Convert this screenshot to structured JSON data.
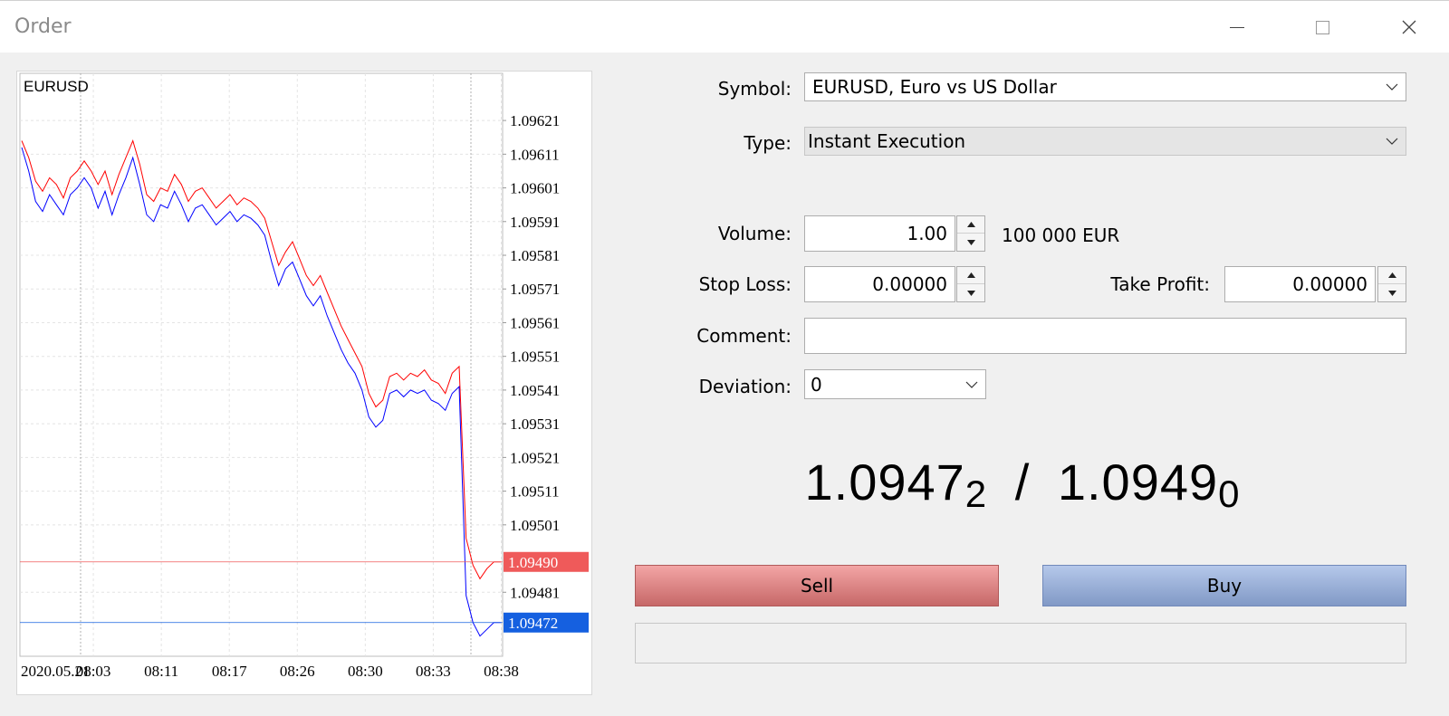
{
  "window": {
    "title": "Order",
    "controls": [
      "minimize",
      "maximize",
      "close"
    ]
  },
  "chart_data": {
    "type": "line",
    "symbol_label": "EURUSD",
    "x_tick_labels": [
      "2020.05.21",
      "08:03",
      "08:11",
      "08:17",
      "08:26",
      "08:30",
      "08:33",
      "08:38"
    ],
    "y_tick_labels": [
      "1.09621",
      "1.09611",
      "1.09601",
      "1.09591",
      "1.09581",
      "1.09571",
      "1.09561",
      "1.09551",
      "1.09541",
      "1.09531",
      "1.09521",
      "1.09511",
      "1.09501",
      "1.09481"
    ],
    "ylim": [
      1.09462,
      1.09635
    ],
    "grid": true,
    "current_ask": {
      "label": "1.09490",
      "value": 1.0949,
      "color": "#ef5a5a"
    },
    "current_bid": {
      "label": "1.09472",
      "value": 1.09472,
      "color": "#1560e0"
    },
    "series": [
      {
        "role": "ask",
        "color": "#ff0000",
        "values": [
          1.09615,
          1.0961,
          1.09603,
          1.096,
          1.09604,
          1.09602,
          1.09598,
          1.09604,
          1.09606,
          1.09609,
          1.09606,
          1.09602,
          1.09606,
          1.09599,
          1.09605,
          1.0961,
          1.09615,
          1.09608,
          1.09599,
          1.09597,
          1.09601,
          1.096,
          1.09605,
          1.09602,
          1.09597,
          1.096,
          1.09601,
          1.09598,
          1.09595,
          1.09597,
          1.09599,
          1.09596,
          1.09598,
          1.09597,
          1.09595,
          1.09592,
          1.09585,
          1.09578,
          1.09582,
          1.09585,
          1.0958,
          1.09575,
          1.09572,
          1.09575,
          1.0957,
          1.09565,
          1.0956,
          1.09556,
          1.09552,
          1.09548,
          1.0954,
          1.09536,
          1.09538,
          1.09545,
          1.09546,
          1.09544,
          1.09546,
          1.09545,
          1.09547,
          1.09544,
          1.09543,
          1.0954,
          1.09546,
          1.09548,
          1.09497,
          1.09489,
          1.09485,
          1.09488,
          1.0949,
          1.0949
        ]
      },
      {
        "role": "bid",
        "color": "#0000ff",
        "values": [
          1.09613,
          1.09606,
          1.09597,
          1.09594,
          1.09599,
          1.09596,
          1.09593,
          1.09599,
          1.09601,
          1.09604,
          1.09601,
          1.09595,
          1.096,
          1.09593,
          1.09599,
          1.09604,
          1.0961,
          1.09602,
          1.09593,
          1.09591,
          1.09596,
          1.09595,
          1.096,
          1.09596,
          1.09591,
          1.09595,
          1.09596,
          1.09593,
          1.0959,
          1.09592,
          1.09594,
          1.09591,
          1.09593,
          1.09592,
          1.0959,
          1.09587,
          1.09579,
          1.09572,
          1.09577,
          1.09579,
          1.09574,
          1.09569,
          1.09566,
          1.09569,
          1.09563,
          1.09558,
          1.09553,
          1.09549,
          1.09546,
          1.09541,
          1.09533,
          1.0953,
          1.09532,
          1.0954,
          1.09541,
          1.09539,
          1.09541,
          1.0954,
          1.09541,
          1.09538,
          1.09537,
          1.09535,
          1.0954,
          1.09542,
          1.0948,
          1.09472,
          1.09468,
          1.0947,
          1.09472,
          1.09472
        ]
      }
    ]
  },
  "form": {
    "symbol_label": "Symbol:",
    "symbol_value": "EURUSD, Euro vs US Dollar",
    "type_label": "Type:",
    "type_value": "Instant Execution",
    "volume_label": "Volume:",
    "volume_value": "1.00",
    "volume_unit": "100 000 EUR",
    "stop_loss_label": "Stop Loss:",
    "stop_loss_value": "0.00000",
    "take_profit_label": "Take Profit:",
    "take_profit_value": "0.00000",
    "comment_label": "Comment:",
    "comment_value": "",
    "deviation_label": "Deviation:",
    "deviation_value": "0"
  },
  "quote": {
    "bid_main": "1.0947",
    "bid_last": "2",
    "separator": "/",
    "ask_main": "1.0949",
    "ask_last": "0"
  },
  "actions": {
    "sell_label": "Sell",
    "buy_label": "Buy"
  }
}
